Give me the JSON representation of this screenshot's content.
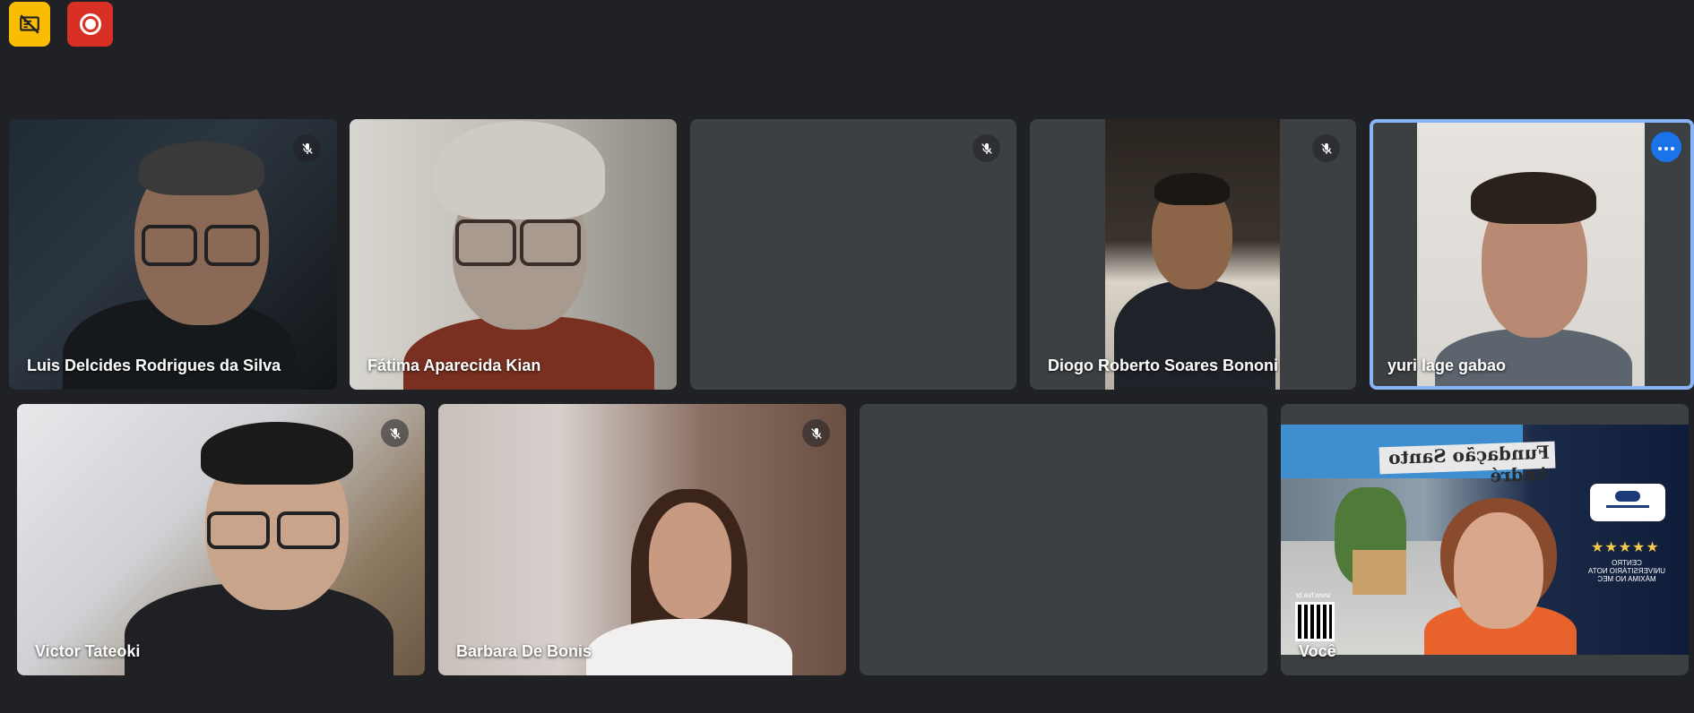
{
  "participants": [
    {
      "name": "Luis Delcides Rodrigues da Silva",
      "muted": true
    },
    {
      "name": "Fátima Aparecida Kian",
      "muted": false
    },
    {
      "name": "",
      "muted": true
    },
    {
      "name": "Diogo Roberto Soares Bononi",
      "muted": true
    },
    {
      "name": "yuri lage gabao",
      "muted": false,
      "active_speaker": true
    },
    {
      "name": "Victor Tateoki",
      "muted": true
    },
    {
      "name": "Barbara De Bonis",
      "muted": true
    },
    {
      "name": "",
      "muted": false
    },
    {
      "name": "Você",
      "muted": false,
      "self": true
    }
  ],
  "self_background": {
    "sign": "Fundação Santo André",
    "stars": "★★★★★",
    "caption": "CENTRO UNIVERSITÁRIO NOTA MÁXIMA NO MEC",
    "site": "www.fsa.br"
  },
  "icons": {
    "top_left": "no-cast-icon",
    "recording": "record-icon",
    "mic_off": "mic-off-icon",
    "more": "more-horizontal-icon"
  },
  "colors": {
    "background": "#202124",
    "tile": "#3c4043",
    "active_border": "#8ab4f8",
    "more_button": "#1a73e8",
    "yellow_button": "#fbbc04",
    "record_button": "#d93025"
  }
}
